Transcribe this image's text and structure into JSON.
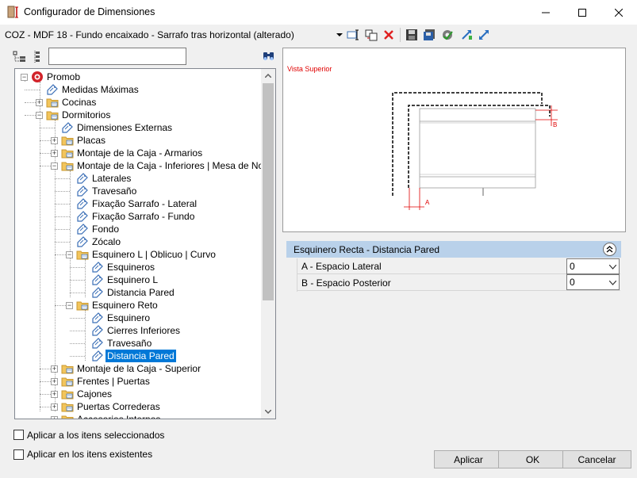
{
  "window": {
    "title": "Configurador de Dimensiones",
    "app_icon": "dimension-config-icon",
    "controls": [
      "minimize-icon",
      "maximize-icon",
      "close-icon"
    ]
  },
  "profile_bar": {
    "current_profile": "COZ - MDF 18 - Fundo encaixado - Sarrafo tras horizontal (alterado)",
    "tools": [
      "dropdown-arrow-icon",
      "rename-icon",
      "copy-icon",
      "delete-icon",
      "save-icon",
      "save-as-icon",
      "settings-icon",
      "import-icon",
      "export-icon"
    ]
  },
  "search": {
    "value": "",
    "icons": [
      "tree-collapse-icon",
      "tree-expand-icon",
      "find-icon"
    ]
  },
  "tree": {
    "items": [
      {
        "label": "Promob"
      },
      {
        "label": "Medidas Máximas"
      },
      {
        "label": "Cocinas"
      },
      {
        "label": "Dormitorios"
      },
      {
        "label": "Dimensiones Externas"
      },
      {
        "label": "Placas"
      },
      {
        "label": "Montaje de la Caja - Armarios"
      },
      {
        "label": "Montaje de la Caja - Inferiores | Mesa de Noche"
      },
      {
        "label": "Laterales"
      },
      {
        "label": "Travesaño"
      },
      {
        "label": "Fixação Sarrafo - Lateral"
      },
      {
        "label": "Fixação Sarrafo - Fundo"
      },
      {
        "label": "Fondo"
      },
      {
        "label": "Zócalo"
      },
      {
        "label": "Esquinero L | Oblicuo | Curvo"
      },
      {
        "label": "Esquineros"
      },
      {
        "label": "Esquinero L"
      },
      {
        "label": "Distancia Pared"
      },
      {
        "label": "Esquinero Reto"
      },
      {
        "label": "Esquinero"
      },
      {
        "label": "Cierres Inferiores"
      },
      {
        "label": "Travesaño"
      },
      {
        "label": "Distancia Pared"
      },
      {
        "label": "Montaje de la Caja - Superior"
      },
      {
        "label": "Frentes | Puertas"
      },
      {
        "label": "Cajones"
      },
      {
        "label": "Puertas Correderas"
      },
      {
        "label": "Accesorios Internos"
      }
    ],
    "selected_index": 22
  },
  "preview": {
    "view_label": "Vista Superior",
    "dim_a_label": "A",
    "dim_b_label": "B",
    "accent_color": "#e00000"
  },
  "properties": {
    "group_title": "Esquinero Recta - Distancia Pared",
    "rows": [
      {
        "label": "A - Espacio Lateral",
        "value": "0"
      },
      {
        "label": "B - Espacio Posterior",
        "value": "0"
      }
    ]
  },
  "options": {
    "apply_selected": {
      "label": "Aplicar a los itens seleccionados",
      "checked": false
    },
    "apply_existing": {
      "label": "Aplicar en los itens existentes",
      "checked": false
    }
  },
  "buttons": {
    "apply": "Aplicar",
    "ok": "OK",
    "cancel": "Cancelar"
  }
}
